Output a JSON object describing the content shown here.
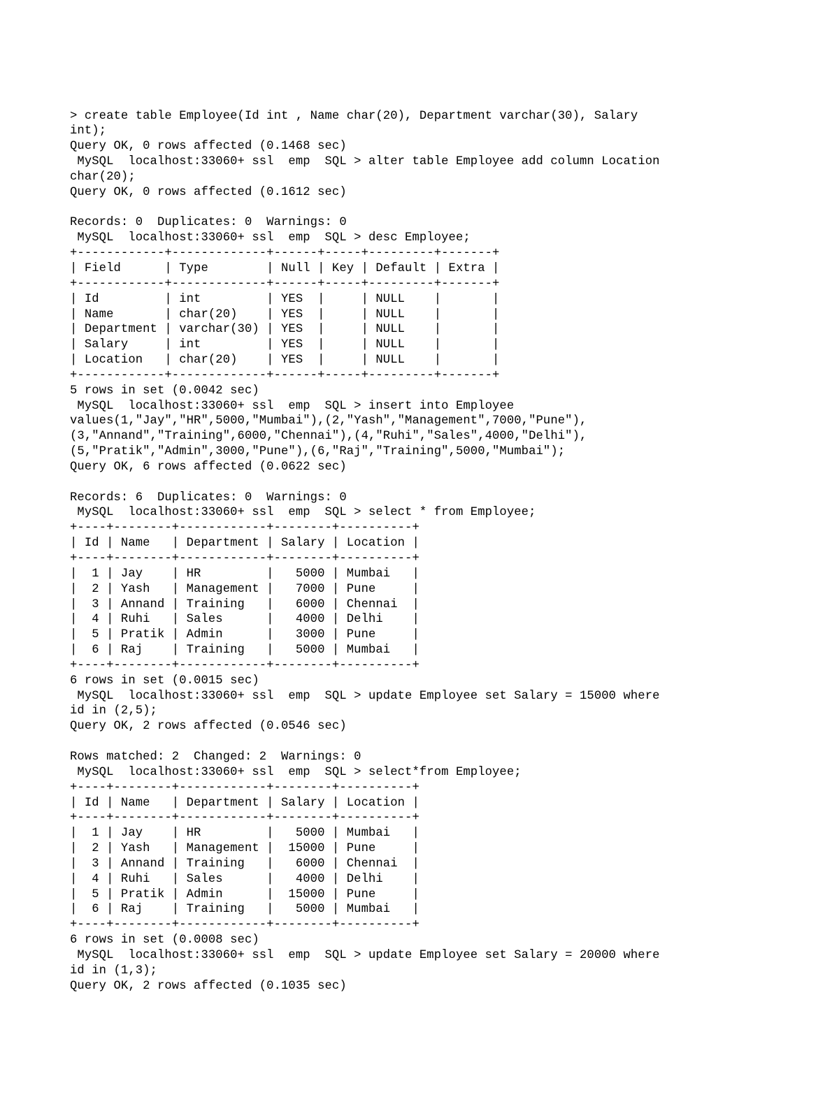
{
  "lines": [
    "> create table Employee(Id int , Name char(20), Department varchar(30), Salary",
    "int);",
    "Query OK, 0 rows affected (0.1468 sec)",
    " MySQL  localhost:33060+ ssl  emp  SQL > alter table Employee add column Location",
    "char(20);",
    "Query OK, 0 rows affected (0.1612 sec)",
    "",
    "Records: 0  Duplicates: 0  Warnings: 0",
    " MySQL  localhost:33060+ ssl  emp  SQL > desc Employee;",
    "+------------+-------------+------+-----+---------+-------+",
    "| Field      | Type        | Null | Key | Default | Extra |",
    "+------------+-------------+------+-----+---------+-------+",
    "| Id         | int         | YES  |     | NULL    |       |",
    "| Name       | char(20)    | YES  |     | NULL    |       |",
    "| Department | varchar(30) | YES  |     | NULL    |       |",
    "| Salary     | int         | YES  |     | NULL    |       |",
    "| Location   | char(20)    | YES  |     | NULL    |       |",
    "+------------+-------------+------+-----+---------+-------+",
    "5 rows in set (0.0042 sec)",
    " MySQL  localhost:33060+ ssl  emp  SQL > insert into Employee",
    "values(1,\"Jay\",\"HR\",5000,\"Mumbai\"),(2,\"Yash\",\"Management\",7000,\"Pune\"),",
    "(3,\"Annand\",\"Training\",6000,\"Chennai\"),(4,\"Ruhi\",\"Sales\",4000,\"Delhi\"),",
    "(5,\"Pratik\",\"Admin\",3000,\"Pune\"),(6,\"Raj\",\"Training\",5000,\"Mumbai\");",
    "Query OK, 6 rows affected (0.0622 sec)",
    "",
    "Records: 6  Duplicates: 0  Warnings: 0",
    " MySQL  localhost:33060+ ssl  emp  SQL > select * from Employee;",
    "+----+--------+------------+--------+----------+",
    "| Id | Name   | Department | Salary | Location |",
    "+----+--------+------------+--------+----------+",
    "|  1 | Jay    | HR         |   5000 | Mumbai   |",
    "|  2 | Yash   | Management |   7000 | Pune     |",
    "|  3 | Annand | Training   |   6000 | Chennai  |",
    "|  4 | Ruhi   | Sales      |   4000 | Delhi    |",
    "|  5 | Pratik | Admin      |   3000 | Pune     |",
    "|  6 | Raj    | Training   |   5000 | Mumbai   |",
    "+----+--------+------------+--------+----------+",
    "6 rows in set (0.0015 sec)",
    " MySQL  localhost:33060+ ssl  emp  SQL > update Employee set Salary = 15000 where",
    "id in (2,5);",
    "Query OK, 2 rows affected (0.0546 sec)",
    "",
    "Rows matched: 2  Changed: 2  Warnings: 0",
    " MySQL  localhost:33060+ ssl  emp  SQL > select*from Employee;",
    "+----+--------+------------+--------+----------+",
    "| Id | Name   | Department | Salary | Location |",
    "+----+--------+------------+--------+----------+",
    "|  1 | Jay    | HR         |   5000 | Mumbai   |",
    "|  2 | Yash   | Management |  15000 | Pune     |",
    "|  3 | Annand | Training   |   6000 | Chennai  |",
    "|  4 | Ruhi   | Sales      |   4000 | Delhi    |",
    "|  5 | Pratik | Admin      |  15000 | Pune     |",
    "|  6 | Raj    | Training   |   5000 | Mumbai   |",
    "+----+--------+------------+--------+----------+",
    "6 rows in set (0.0008 sec)",
    " MySQL  localhost:33060+ ssl  emp  SQL > update Employee set Salary = 20000 where",
    "id in (1,3);",
    "Query OK, 2 rows affected (0.1035 sec)"
  ]
}
